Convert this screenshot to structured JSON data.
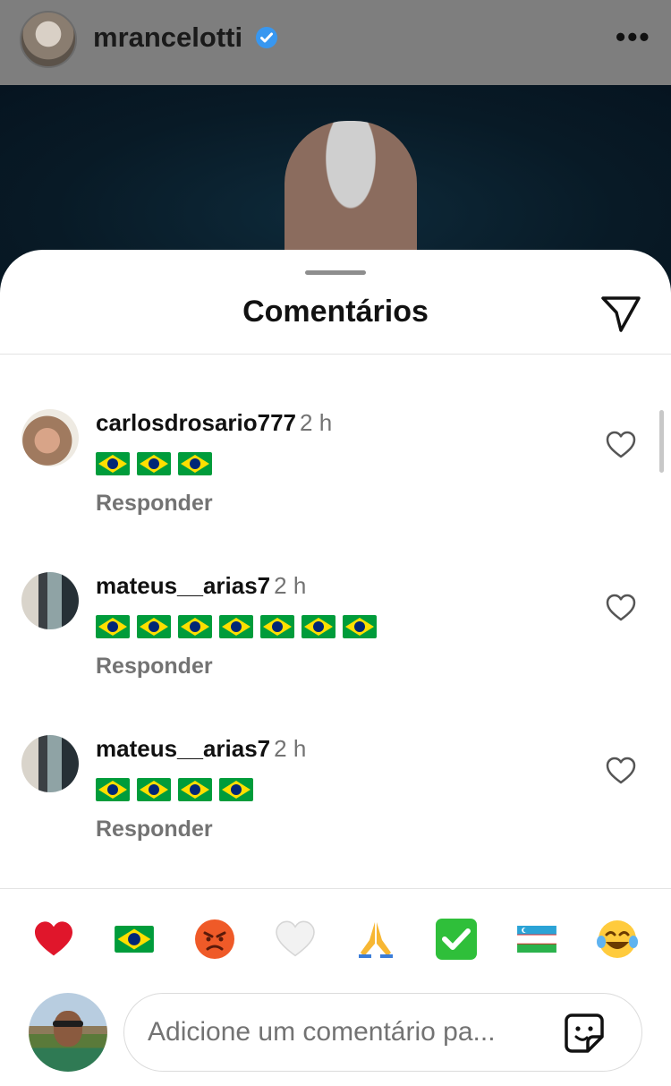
{
  "post": {
    "username": "mrancelotti",
    "more_label": "•••"
  },
  "sheet": {
    "title": "Comentários"
  },
  "comments": [
    {
      "username": "carlosdrosario777",
      "time": "2 h",
      "flags": 3,
      "reply_label": "Responder"
    },
    {
      "username": "mateus__arias7",
      "time": "2 h",
      "flags": 7,
      "reply_label": "Responder"
    },
    {
      "username": "mateus__arias7",
      "time": "2 h",
      "flags": 4,
      "reply_label": "Responder"
    }
  ],
  "emoji_bar": [
    "❤️",
    "🇧🇷",
    "😡",
    "🤍",
    "🙏",
    "✅",
    "🇺🇿",
    "😂"
  ],
  "composer": {
    "placeholder": "Adicione um comentário pa..."
  },
  "colors": {
    "verified": "#3897f0",
    "secondary_text": "#737373",
    "brazil_green": "#009c3b",
    "brazil_yellow": "#ffdf00",
    "brazil_blue": "#002776"
  }
}
